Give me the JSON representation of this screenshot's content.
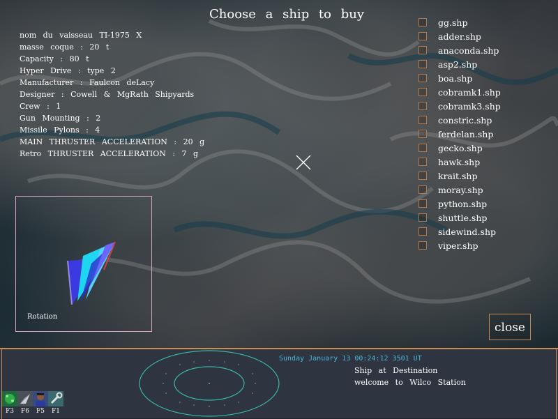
{
  "title": "Choose a ship to buy",
  "ship_info": [
    "nom du vaisseau TI-1975 X",
    "masse coque : 20 t",
    "Capacity : 80 t",
    "Hyper Drive : type 2",
    "Manufacturer : Faulcon deLacy",
    "Designer : Cowell & MgRath Shipyards",
    "Crew : 1",
    "Gun Mounting : 2",
    "Missile Pylons : 4",
    "MAIN THRUSTER ACCELERATION : 20 g",
    "Retro THRUSTER ACCELERATION : 7 g"
  ],
  "ships": [
    "gg.shp",
    "adder.shp",
    "anaconda.shp",
    "asp2.shp",
    "boa.shp",
    "cobramk1.shp",
    "cobramk3.shp",
    "constric.shp",
    "ferdelan.shp",
    "gecko.shp",
    "hawk.shp",
    "krait.shp",
    "moray.shp",
    "python.shp",
    "shuttle.shp",
    "sidewind.shp",
    "viper.shp"
  ],
  "rotation_label": "Rotation",
  "close_label": "close",
  "status": {
    "datetime": "Sunday January 13 00:24:12 3501 UT",
    "message_line1": "Ship at Destination",
    "message_line2": "welcome to Wilco Station"
  },
  "function_keys": [
    {
      "label": "F3",
      "icon": "map-icon"
    },
    {
      "label": "F6",
      "icon": "ship-info-icon"
    },
    {
      "label": "F5",
      "icon": "pilot-icon"
    },
    {
      "label": "F1",
      "icon": "wrench-icon"
    }
  ],
  "colors": {
    "accent_border": "#c98e55",
    "status_text": "#49b5d6",
    "radar": "#3ab6a6",
    "rotation_border": "#d7a0c8"
  }
}
